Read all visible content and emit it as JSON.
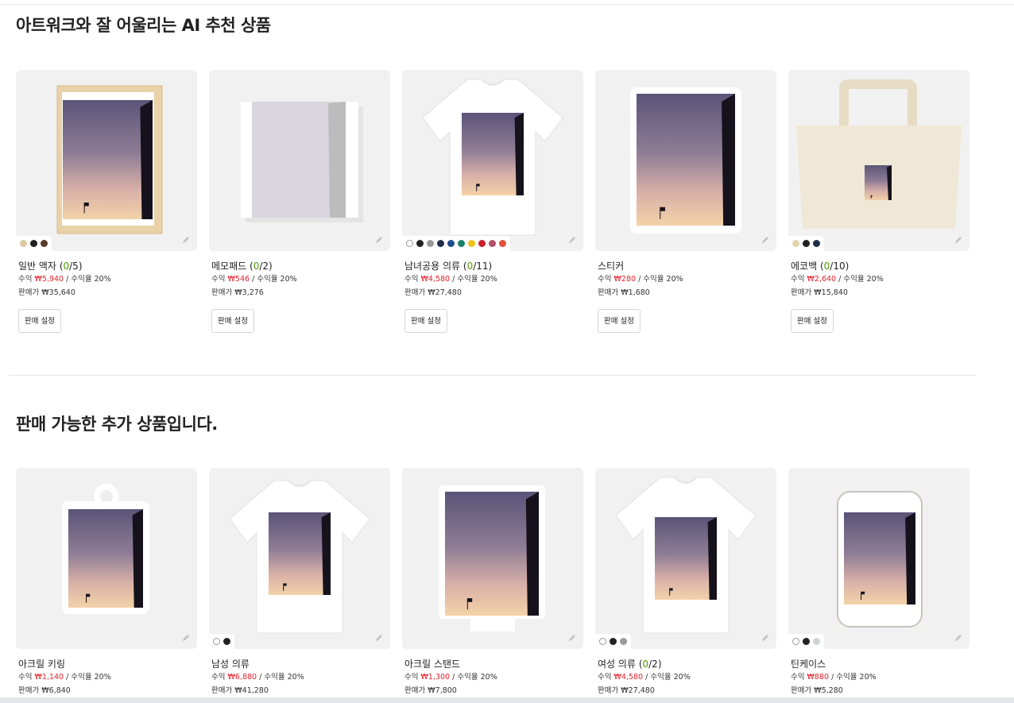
{
  "section1": {
    "title": "아트워크와 잘 어울리는 AI 추천 상품",
    "products": [
      {
        "name": "일반 액자",
        "count_open": "(",
        "count_num": "0",
        "count_rest": "/5)",
        "profit_label": "수익",
        "profit_amount": "₩5,940",
        "rate": "/ 수익율 20%",
        "price_label": "판매가",
        "price": "₩35,640",
        "button": "판매 설정",
        "colors": [
          "#dcc9a4",
          "#222222",
          "#5a3a2a"
        ],
        "mockup": "frame"
      },
      {
        "name": "메모패드",
        "count_open": "(",
        "count_num": "0",
        "count_rest": "/2)",
        "profit_label": "수익",
        "profit_amount": "₩546",
        "rate": "/ 수익율 20%",
        "price_label": "판매가",
        "price": "₩3,276",
        "button": "판매 설정",
        "colors": [],
        "mockup": "memopad"
      },
      {
        "name": "남녀공용 의류",
        "count_open": "(",
        "count_num": "0",
        "count_rest": "/11)",
        "profit_label": "수익",
        "profit_amount": "₩4,580",
        "rate": "/ 수익율 20%",
        "price_label": "판매가",
        "price": "₩27,480",
        "button": "판매 설정",
        "colors": [
          "#ffffff",
          "#222222",
          "#9a9a9a",
          "#1f2f4a",
          "#1e4f8c",
          "#17806a",
          "#f2c21a",
          "#c8202c",
          "#b4506a",
          "#e0503a"
        ],
        "mockup": "tshirt"
      },
      {
        "name": "스티커",
        "count_open": "",
        "count_num": "",
        "count_rest": "",
        "profit_label": "수익",
        "profit_amount": "₩280",
        "rate": "/ 수익율 20%",
        "price_label": "판매가",
        "price": "₩1,680",
        "button": "판매 설정",
        "colors": [],
        "mockup": "sticker"
      },
      {
        "name": "에코백",
        "count_open": "(",
        "count_num": "0",
        "count_rest": "/10)",
        "profit_label": "수익",
        "profit_amount": "₩2,640",
        "rate": "/ 수익율 20%",
        "price_label": "판매가",
        "price": "₩15,840",
        "button": "판매 설정",
        "colors": [
          "#e2d3ad",
          "#222222",
          "#1f2f4a"
        ],
        "mockup": "ecobag"
      }
    ]
  },
  "section2": {
    "title": "판매 가능한 추가 상품입니다.",
    "products": [
      {
        "name": "아크릴 키링",
        "count_open": "",
        "count_num": "",
        "count_rest": "",
        "profit_label": "수익",
        "profit_amount": "₩1,140",
        "rate": "/ 수익율 20%",
        "price_label": "판매가",
        "price": "₩6,840",
        "colors": [],
        "mockup": "keyring"
      },
      {
        "name": "남성 의류",
        "count_open": "",
        "count_num": "",
        "count_rest": "",
        "profit_label": "수익",
        "profit_amount": "₩6,880",
        "rate": "/ 수익율 20%",
        "price_label": "판매가",
        "price": "₩41,280",
        "colors": [
          "#ffffff",
          "#222222"
        ],
        "mockup": "tshirt-men"
      },
      {
        "name": "아크릴 스탠드",
        "count_open": "",
        "count_num": "",
        "count_rest": "",
        "profit_label": "수익",
        "profit_amount": "₩1,300",
        "rate": "/ 수익율 20%",
        "price_label": "판매가",
        "price": "₩7,800",
        "colors": [],
        "mockup": "stand"
      },
      {
        "name": "여성 의류",
        "count_open": "(",
        "count_num": "0",
        "count_rest": "/2)",
        "profit_label": "수익",
        "profit_amount": "₩4,580",
        "rate": "/ 수익율 20%",
        "price_label": "판매가",
        "price": "₩27,480",
        "colors": [
          "#ffffff",
          "#222222",
          "#9a9a9a"
        ],
        "mockup": "tshirt-women"
      },
      {
        "name": "틴케이스",
        "count_open": "",
        "count_num": "",
        "count_rest": "",
        "profit_label": "수익",
        "profit_amount": "₩880",
        "rate": "/ 수익율 20%",
        "price_label": "판매가",
        "price": "₩5,280",
        "colors": [
          "#ffffff",
          "#222222",
          "#cfd3d6"
        ],
        "mockup": "tincase"
      }
    ]
  },
  "icons": {
    "edit": "pencil-icon"
  }
}
